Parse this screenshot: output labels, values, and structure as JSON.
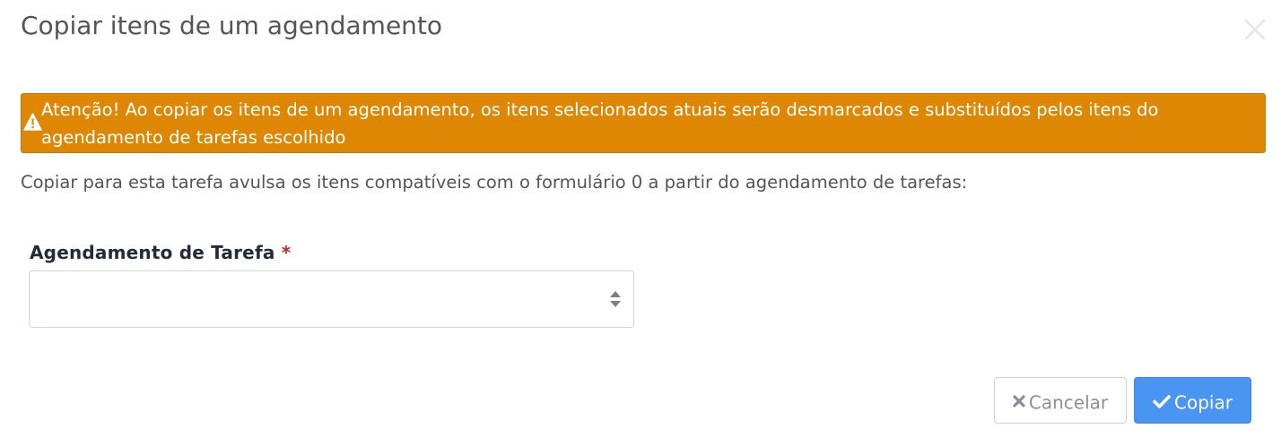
{
  "dialog": {
    "title": "Copiar itens de um agendamento",
    "close_icon": "close-icon"
  },
  "alert": {
    "icon": "warning-icon",
    "text": "Atenção! Ao copiar os itens de um agendamento, os itens selecionados atuais serão desmarcados e substituídos pelos itens do agendamento de tarefas escolhido",
    "background": "#de8705"
  },
  "info": {
    "text": "Copiar para esta tarefa avulsa os itens compatíveis com o formulário 0 a partir do agendamento de tarefas:"
  },
  "form": {
    "field_label": "Agendamento de Tarefa",
    "required_mark": "*",
    "selected_value": ""
  },
  "buttons": {
    "cancel_label": "Cancelar",
    "cancel_icon": "times-icon",
    "submit_label": "Copiar",
    "submit_icon": "check-icon",
    "submit_color": "#4a95f2"
  }
}
